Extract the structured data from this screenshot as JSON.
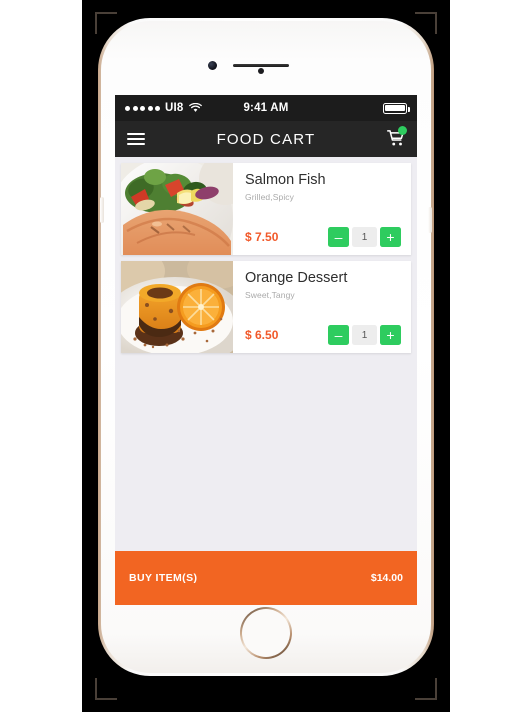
{
  "status_bar": {
    "signal_dots": 5,
    "carrier": "UI8",
    "wifi_icon": "wifi-icon",
    "time": "9:41 AM",
    "battery_icon": "battery-full-icon"
  },
  "nav_bar": {
    "menu_icon": "hamburger-menu-icon",
    "title": "FOOD CART",
    "cart_icon": "shopping-cart-icon",
    "cart_badge_color": "#2ecc5f"
  },
  "cart": {
    "items": [
      {
        "name": "Salmon Fish",
        "description": "Grilled,Spicy",
        "price": "$ 7.50",
        "quantity": "1",
        "decrement_label": "–",
        "increment_label": "+",
        "image_alt": "grilled-salmon-with-salad"
      },
      {
        "name": "Orange Dessert",
        "description": "Sweet,Tangy",
        "price": "$ 6.50",
        "quantity": "1",
        "decrement_label": "–",
        "increment_label": "+",
        "image_alt": "orange-cake-with-orange-slice"
      }
    ]
  },
  "buy_bar": {
    "label": "BUY ITEM(S)",
    "total": "$14.00",
    "background_color": "#f26522"
  },
  "theme": {
    "accent_orange": "#f26522",
    "price_orange": "#f1592a",
    "accent_green": "#2ecc5f",
    "screen_background": "#eeedf2",
    "navbar_background": "#262626",
    "statusbar_background": "#1c1c1c"
  }
}
